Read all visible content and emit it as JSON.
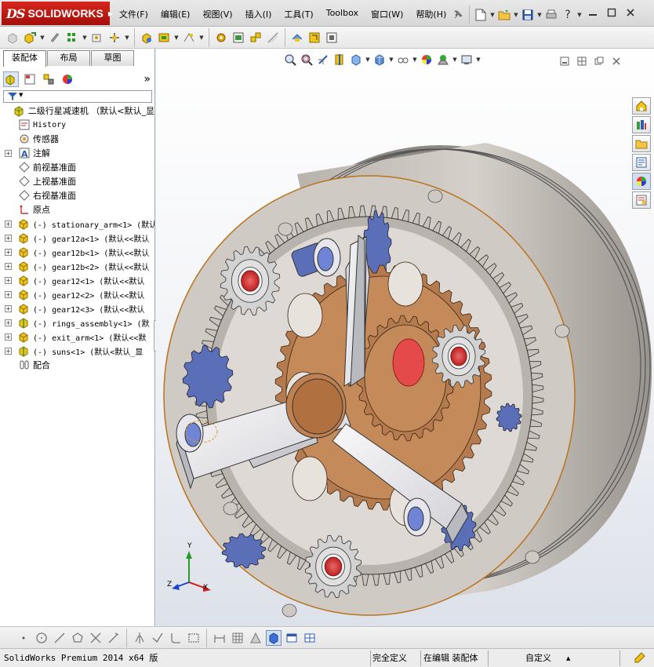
{
  "app": {
    "logo_ds": "DS",
    "logo_text": "SOLIDWORKS"
  },
  "menu": [
    {
      "label": "文件(F)"
    },
    {
      "label": "编辑(E)"
    },
    {
      "label": "视图(V)"
    },
    {
      "label": "插入(I)"
    },
    {
      "label": "工具(T)"
    },
    {
      "label": "Toolbox"
    },
    {
      "label": "窗口(W)"
    },
    {
      "label": "帮助(H)"
    }
  ],
  "help_glyph": "?",
  "panel": {
    "tabs": [
      "装配体",
      "布局",
      "草图"
    ],
    "expand_glyph": "»"
  },
  "tree": [
    {
      "label": "二级行星减速机 （默认<默认_显",
      "icon": "assembly-icon",
      "expand": false,
      "mono": false
    },
    {
      "label": "History",
      "icon": "history-icon",
      "expand": false,
      "mono": true
    },
    {
      "label": "传感器",
      "icon": "sensor-icon",
      "expand": false,
      "mono": false
    },
    {
      "label": "注解",
      "icon": "annotation-icon",
      "expand": true,
      "mono": false
    },
    {
      "label": "前视基准面",
      "icon": "plane-icon",
      "expand": false,
      "mono": false
    },
    {
      "label": "上视基准面",
      "icon": "plane-icon",
      "expand": false,
      "mono": false
    },
    {
      "label": "右视基准面",
      "icon": "plane-icon",
      "expand": false,
      "mono": false
    },
    {
      "label": "原点",
      "icon": "origin-icon",
      "expand": false,
      "mono": false
    },
    {
      "label": "(-) stationary_arm<1> (默认",
      "icon": "part-icon",
      "expand": true,
      "mono": true
    },
    {
      "label": "(-) gear12a<1> (默认<<默认",
      "icon": "part-icon",
      "expand": true,
      "mono": true
    },
    {
      "label": "(-) gear12b<1> (默认<<默认",
      "icon": "part-icon",
      "expand": true,
      "mono": true
    },
    {
      "label": "(-) gear12b<2> (默认<<默认",
      "icon": "part-icon",
      "expand": true,
      "mono": true
    },
    {
      "label": "(-) gear12<1> (默认<<默认",
      "icon": "part-icon",
      "expand": true,
      "mono": true
    },
    {
      "label": "(-) gear12<2> (默认<<默认",
      "icon": "part-icon",
      "expand": true,
      "mono": true
    },
    {
      "label": "(-) gear12<3> (默认<<默认",
      "icon": "part-icon",
      "expand": true,
      "mono": true
    },
    {
      "label": "(-) rings_assembly<1> (默",
      "icon": "subassembly-icon",
      "expand": true,
      "mono": true
    },
    {
      "label": "(-) exit_arm<1> (默认<<默",
      "icon": "part-icon",
      "expand": true,
      "mono": true
    },
    {
      "label": "(-) suns<1> (默认<默认_显",
      "icon": "subassembly-icon",
      "expand": true,
      "mono": true
    },
    {
      "label": "配合",
      "icon": "mates-icon",
      "expand": false,
      "mono": false
    }
  ],
  "triad": {
    "x": "X",
    "y": "Y",
    "z": "Z"
  },
  "status": {
    "product": "SolidWorks Premium 2014 x64 版",
    "definition": "完全定义",
    "editing": "在编辑 装配体",
    "units": "自定义",
    "units_arrow": "▲"
  },
  "colors": {
    "brand_red": "#c8201a",
    "gear_bronze": "#b57a4e",
    "ring_gray": "#c8c2bc",
    "arm_white": "#ebebee",
    "planet_gray": "#d2d2d2",
    "sun_blue": "#5a6fb8"
  }
}
